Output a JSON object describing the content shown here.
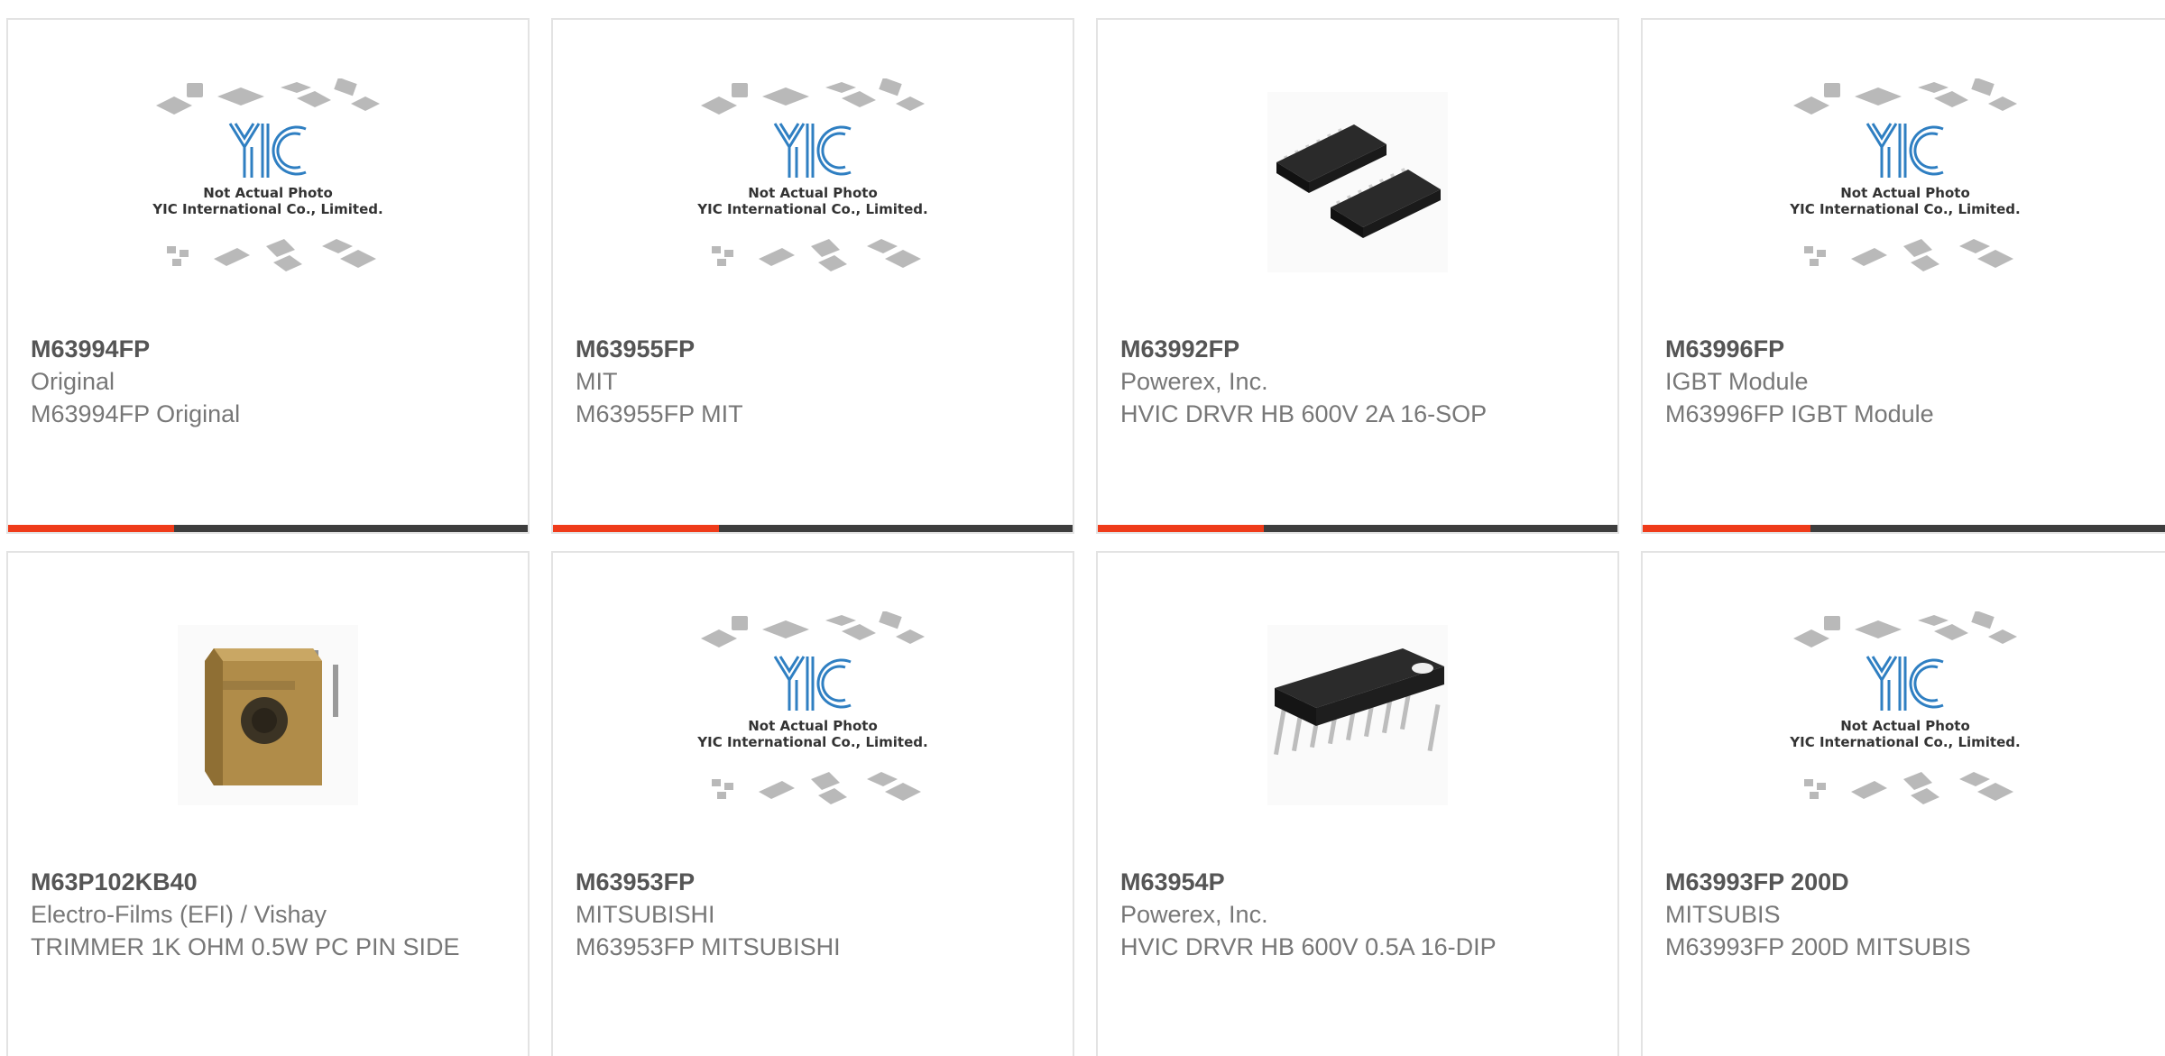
{
  "colors": {
    "accent": "#ef3b1a",
    "bar": "#3d3d3d",
    "border": "#e3e3e3",
    "logo_blue": "#2f7fc2"
  },
  "placeholder_caption": {
    "line1": "Not Actual Photo",
    "line2": "YIC International Co., Limited.",
    "logo_text": "YIC"
  },
  "cards": [
    {
      "part": "M63994FP",
      "manufacturer": "Original",
      "description": "M63994FP Original",
      "image": "placeholder-icon",
      "progress": 0.32
    },
    {
      "part": "M63955FP",
      "manufacturer": "MIT",
      "description": "M63955FP MIT",
      "image": "placeholder-icon",
      "progress": 0.32
    },
    {
      "part": "M63992FP",
      "manufacturer": "Powerex, Inc.",
      "description": "HVIC DRVR HB 600V 2A 16-SOP",
      "image": "sop-chip-icon",
      "progress": 0.32
    },
    {
      "part": "M63996FP",
      "manufacturer": "IGBT Module",
      "description": "M63996FP IGBT Module",
      "image": "placeholder-icon",
      "progress": 0.32
    },
    {
      "part": "M63P102KB40",
      "manufacturer": "Electro-Films (EFI) / Vishay",
      "description": "TRIMMER 1K OHM 0.5W PC PIN SIDE",
      "image": "trimmer-icon"
    },
    {
      "part": "M63953FP",
      "manufacturer": "MITSUBISHI",
      "description": "M63953FP MITSUBISHI",
      "image": "placeholder-icon"
    },
    {
      "part": "M63954P",
      "manufacturer": "Powerex, Inc.",
      "description": "HVIC DRVR HB 600V 0.5A 16-DIP",
      "image": "dip-chip-icon"
    },
    {
      "part": "M63993FP 200D",
      "manufacturer": "MITSUBIS",
      "description": "M63993FP 200D MITSUBIS",
      "image": "placeholder-icon"
    }
  ]
}
